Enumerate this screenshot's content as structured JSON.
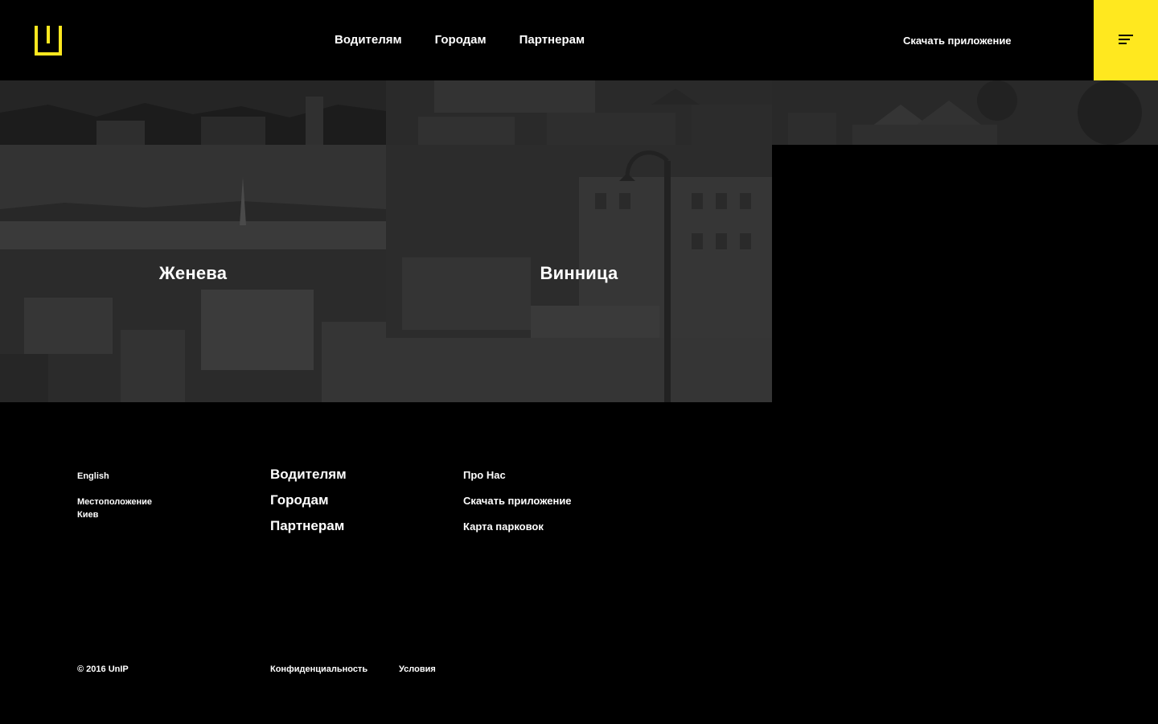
{
  "brand": {
    "accent_color": "#ffe81f",
    "logo_icon": "bracket-u-logo"
  },
  "header": {
    "nav": [
      "Водителям",
      "Городам",
      "Партнерам"
    ],
    "download_label": "Скачать приложение",
    "menu_icon": "hamburger-menu-icon"
  },
  "cities": {
    "top_row": [
      "",
      "",
      ""
    ],
    "geneva": "Женева",
    "vinnytsia": "Винница"
  },
  "footer": {
    "language": "English",
    "location_label": "Местоположение",
    "location_value": "Киев",
    "main_links": [
      "Водителям",
      "Городам",
      "Партнерам"
    ],
    "secondary_links": [
      "Про Нас",
      "Скачать приложение",
      "Карта парковок"
    ],
    "copyright": "© 2016 UnIP",
    "privacy": "Конфиденциальность",
    "terms": "Условия"
  }
}
